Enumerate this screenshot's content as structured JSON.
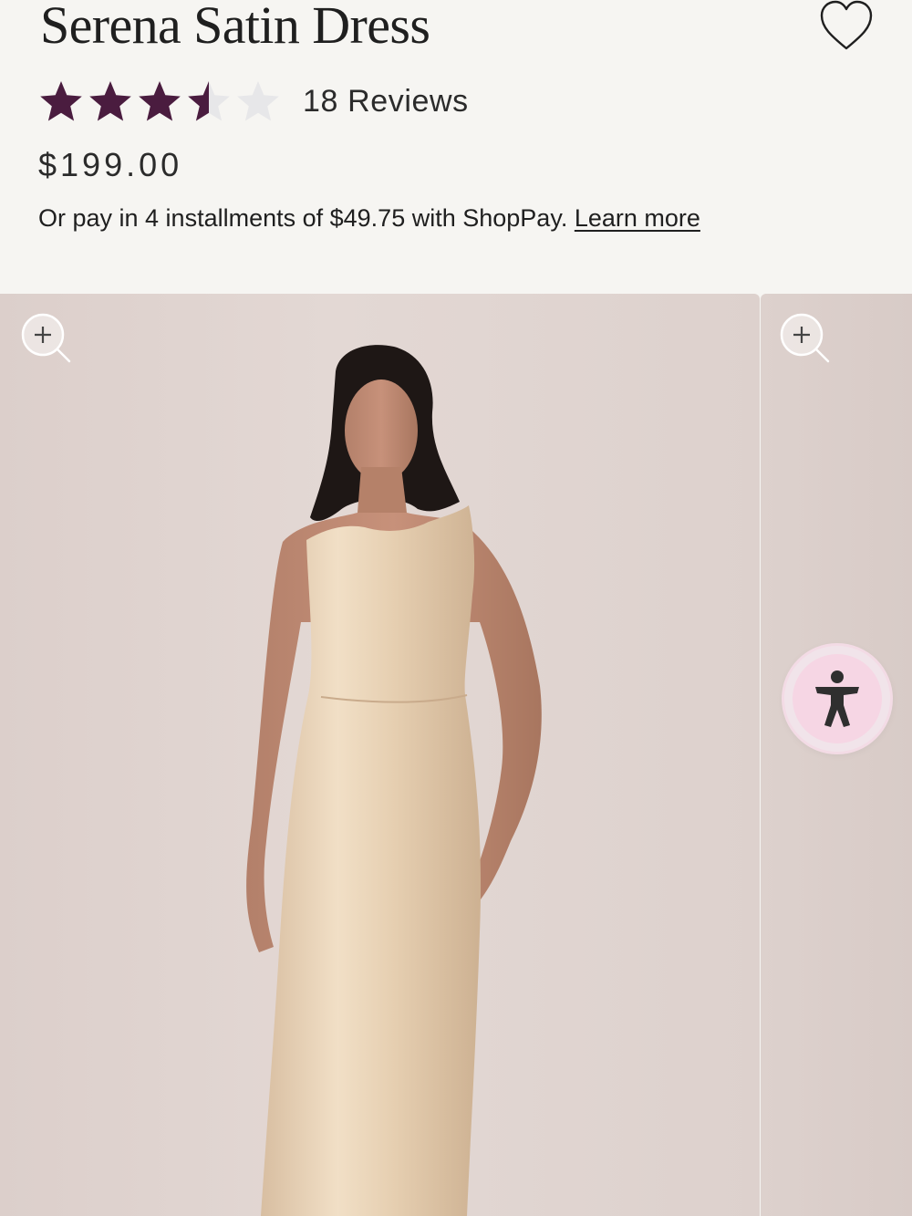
{
  "product": {
    "title": "Serena Satin Dress",
    "rating": 3.5,
    "rating_max": 5,
    "reviews_label": "18 Reviews",
    "price": "$199.00",
    "installments_text": "Or pay in 4 installments of $49.75 with ShopPay.",
    "learn_more_label": "Learn more"
  },
  "icons": {
    "wishlist": "heart-outline-icon",
    "zoom": "zoom-in-icon",
    "accessibility": "accessibility-person-icon"
  },
  "colors": {
    "star_filled": "#4a1c3f",
    "star_empty": "#e7e7e9",
    "accessibility_bg": "#f6d6e4"
  }
}
